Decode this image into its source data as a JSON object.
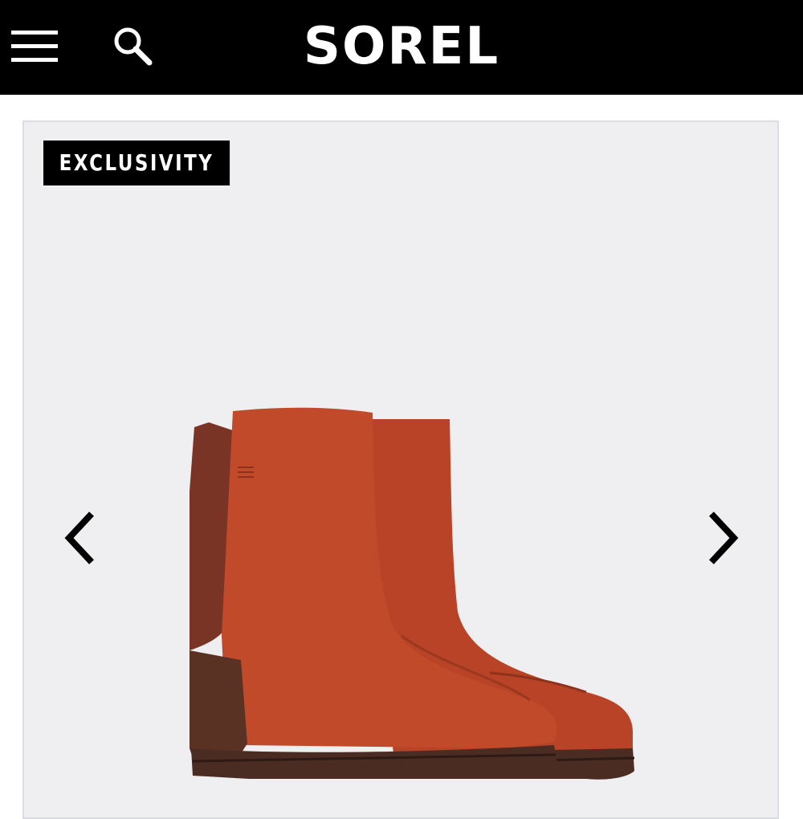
{
  "header": {
    "logo_text": "SOREL",
    "menu_icon": "hamburger-menu-icon",
    "search_icon": "search-icon",
    "background_color": "#000000"
  },
  "gallery": {
    "badge_label": "EXCLUSIVITY",
    "prev_icon": "chevron-left-icon",
    "next_icon": "chevron-right-icon",
    "background_color": "#efeef0"
  },
  "product": {
    "image_subject": "rust suede chelsea ankle boots with block heel",
    "colors": {
      "suede": "#c04a2a",
      "heel_panel": "#7a3426",
      "sole": "#4a2c22"
    }
  }
}
